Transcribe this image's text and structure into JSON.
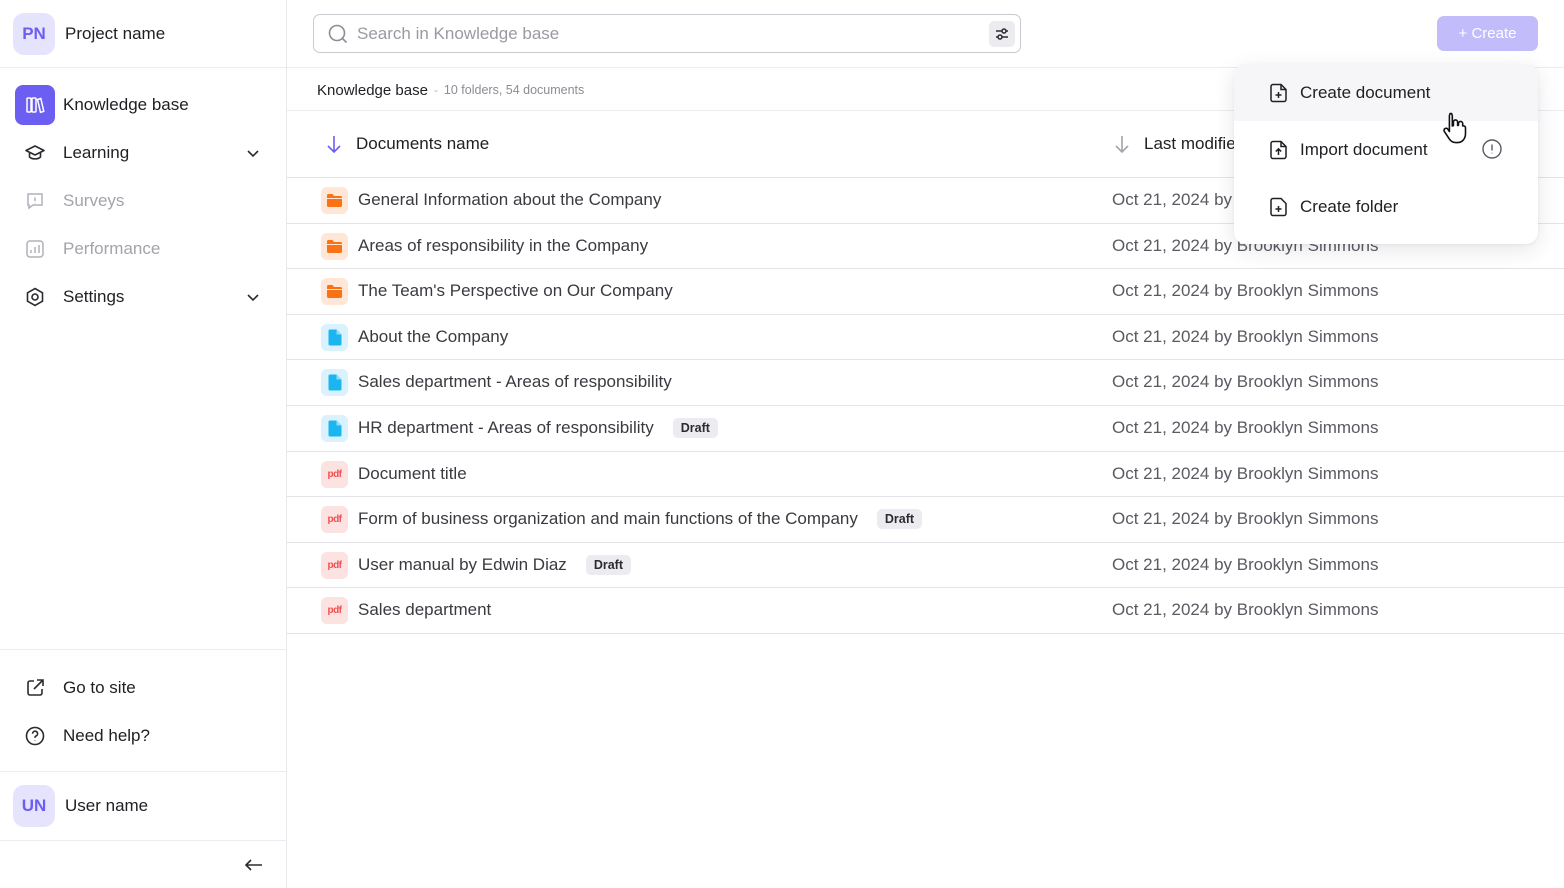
{
  "project": {
    "initials": "PN",
    "name": "Project name"
  },
  "sidebar": {
    "items": [
      {
        "label": "Knowledge base",
        "icon": "books-icon",
        "active": true
      },
      {
        "label": "Learning",
        "icon": "graduation-cap-icon",
        "expandable": true
      },
      {
        "label": "Surveys",
        "icon": "survey-bubble-icon",
        "disabled": true
      },
      {
        "label": "Performance",
        "icon": "chart-icon",
        "disabled": true
      },
      {
        "label": "Settings",
        "icon": "settings-icon",
        "expandable": true
      }
    ],
    "bottom": [
      {
        "label": "Go to site",
        "icon": "external-link-icon"
      },
      {
        "label": "Need help?",
        "icon": "help-icon"
      }
    ]
  },
  "user": {
    "initials": "UN",
    "name": "User name"
  },
  "search": {
    "placeholder": "Search in Knowledge base"
  },
  "toolbar": {
    "create_label": "+ Create"
  },
  "breadcrumb": {
    "title": "Knowledge base",
    "separator": "-",
    "meta": "10 folders, 54 documents"
  },
  "table": {
    "columns": [
      "Documents name",
      "Last modifie"
    ],
    "rows": [
      {
        "type": "folder",
        "name": "General Information about the Company",
        "modified": "Oct 21, 2024 by"
      },
      {
        "type": "folder",
        "name": "Areas of responsibility in the Company",
        "modified": "Oct 21, 2024 by Brooklyn Simmons"
      },
      {
        "type": "folder",
        "name": "The Team's Perspective on Our Company",
        "modified": "Oct 21, 2024 by Brooklyn Simmons"
      },
      {
        "type": "doc",
        "name": "About the Company",
        "modified": "Oct 21, 2024 by Brooklyn Simmons"
      },
      {
        "type": "doc",
        "name": "Sales department - Areas of responsibility",
        "modified": "Oct 21, 2024 by Brooklyn Simmons"
      },
      {
        "type": "doc",
        "name": "HR department - Areas of responsibility",
        "draft": "Draft",
        "modified": "Oct 21, 2024 by Brooklyn Simmons"
      },
      {
        "type": "pdf",
        "name": "Document title",
        "modified": "Oct 21, 2024 by Brooklyn Simmons"
      },
      {
        "type": "pdf",
        "name": "Form of business organization and main functions of the Company",
        "draft": "Draft",
        "modified": "Oct 21, 2024 by Brooklyn Simmons"
      },
      {
        "type": "pdf",
        "name": "User manual by Edwin Diaz",
        "draft": "Draft",
        "modified": "Oct 21, 2024 by Brooklyn Simmons"
      },
      {
        "type": "pdf",
        "name": "Sales department",
        "modified": "Oct 21, 2024 by Brooklyn Simmons"
      }
    ],
    "pdf_label": "pdf"
  },
  "create_menu": {
    "items": [
      {
        "label": "Create document",
        "icon": "file-plus-icon"
      },
      {
        "label": "Import document",
        "icon": "file-upload-icon"
      },
      {
        "label": "Create folder",
        "icon": "folder-plus-icon"
      }
    ]
  },
  "colors": {
    "accent": "#6d5ef2",
    "create_button": "#c3bcfa",
    "folder": "#f97316",
    "doc": "#1bb6ef",
    "pdf": "#ef4f4f"
  }
}
